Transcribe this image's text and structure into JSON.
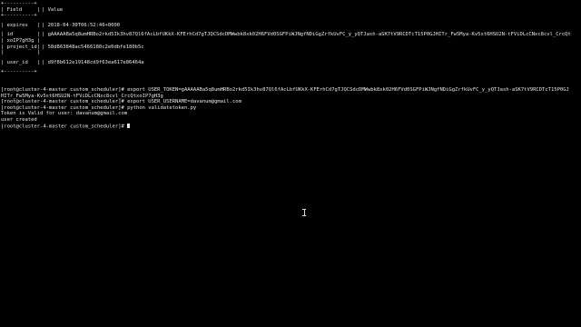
{
  "table": {
    "border_top": "+----------+",
    "header_field": "| Field     |",
    "header_value": "| Value",
    "border_mid": "+----------+",
    "rows": [
      {
        "field": "| expires   |",
        "value": "| 2018-04-30T06:52:46+0000"
      },
      {
        "field": "| id        |",
        "value": "| gAAAAABa5q8umHRBo2rkd5Ik3hv87Ql6fAcLbfUKkX-KFErhCd7gTJQCSdcDMWwbk8xk02H6FVd0SGFPiWJNgfNDiGgZrfkUvFC_y_yQTJash-aSK7tV9RCDTcT15P0GJHITr_Fw5Mya-Kv5st6HSU2N-tFViDLcCNxc8cvl_CrcQt"
      },
      {
        "field": "| xoIP7gH3g |",
        "value": ""
      },
      {
        "field": "| project_id|",
        "value": "| 58d863848ac5466180c2e0dbfe180b5c"
      },
      {
        "field": "|           |",
        "value": ""
      },
      {
        "field": "| user_id   |",
        "value": "| d9f8b612e19148cd9f63ea617e86464a"
      }
    ],
    "border_bottom": "+----------+"
  },
  "terminal_lines": [
    "[root@cluster-4-master custom_scheduler]# export USER_TOKEN=gAAAAABa5q8umHRBo2rkd5Ik3hv87Ql6fAcLbfUKkX-KFErhCd7gTJQCSdcDMWwbk8xk02H6FVd0SGFPiWJNgfNDiGgZrfkUvFC_y_yQTJash-aSK7tV9RCDTcT15P0GJ",
    "HITr_Fw5Mya-Kv5st6HSU2N-tFViDLcCNxc8cvl_CrcQtxoIP7gH3g",
    "[root@cluster-4-master custom_scheduler]# export USER_USERNAME=davanum@gmail.com",
    "[root@cluster-4-master custom_scheduler]# python validatetoken.py",
    "Token is Valid for user: davanum@gmail.com",
    "user created"
  ],
  "prompt": "[root@cluster-4-master custom_scheduler]# ",
  "colors": {
    "background": "#000000",
    "foreground": "#e6e6e6"
  },
  "icons": {
    "cursor": "block-cursor-icon",
    "mouse": "i-beam-cursor-icon"
  }
}
